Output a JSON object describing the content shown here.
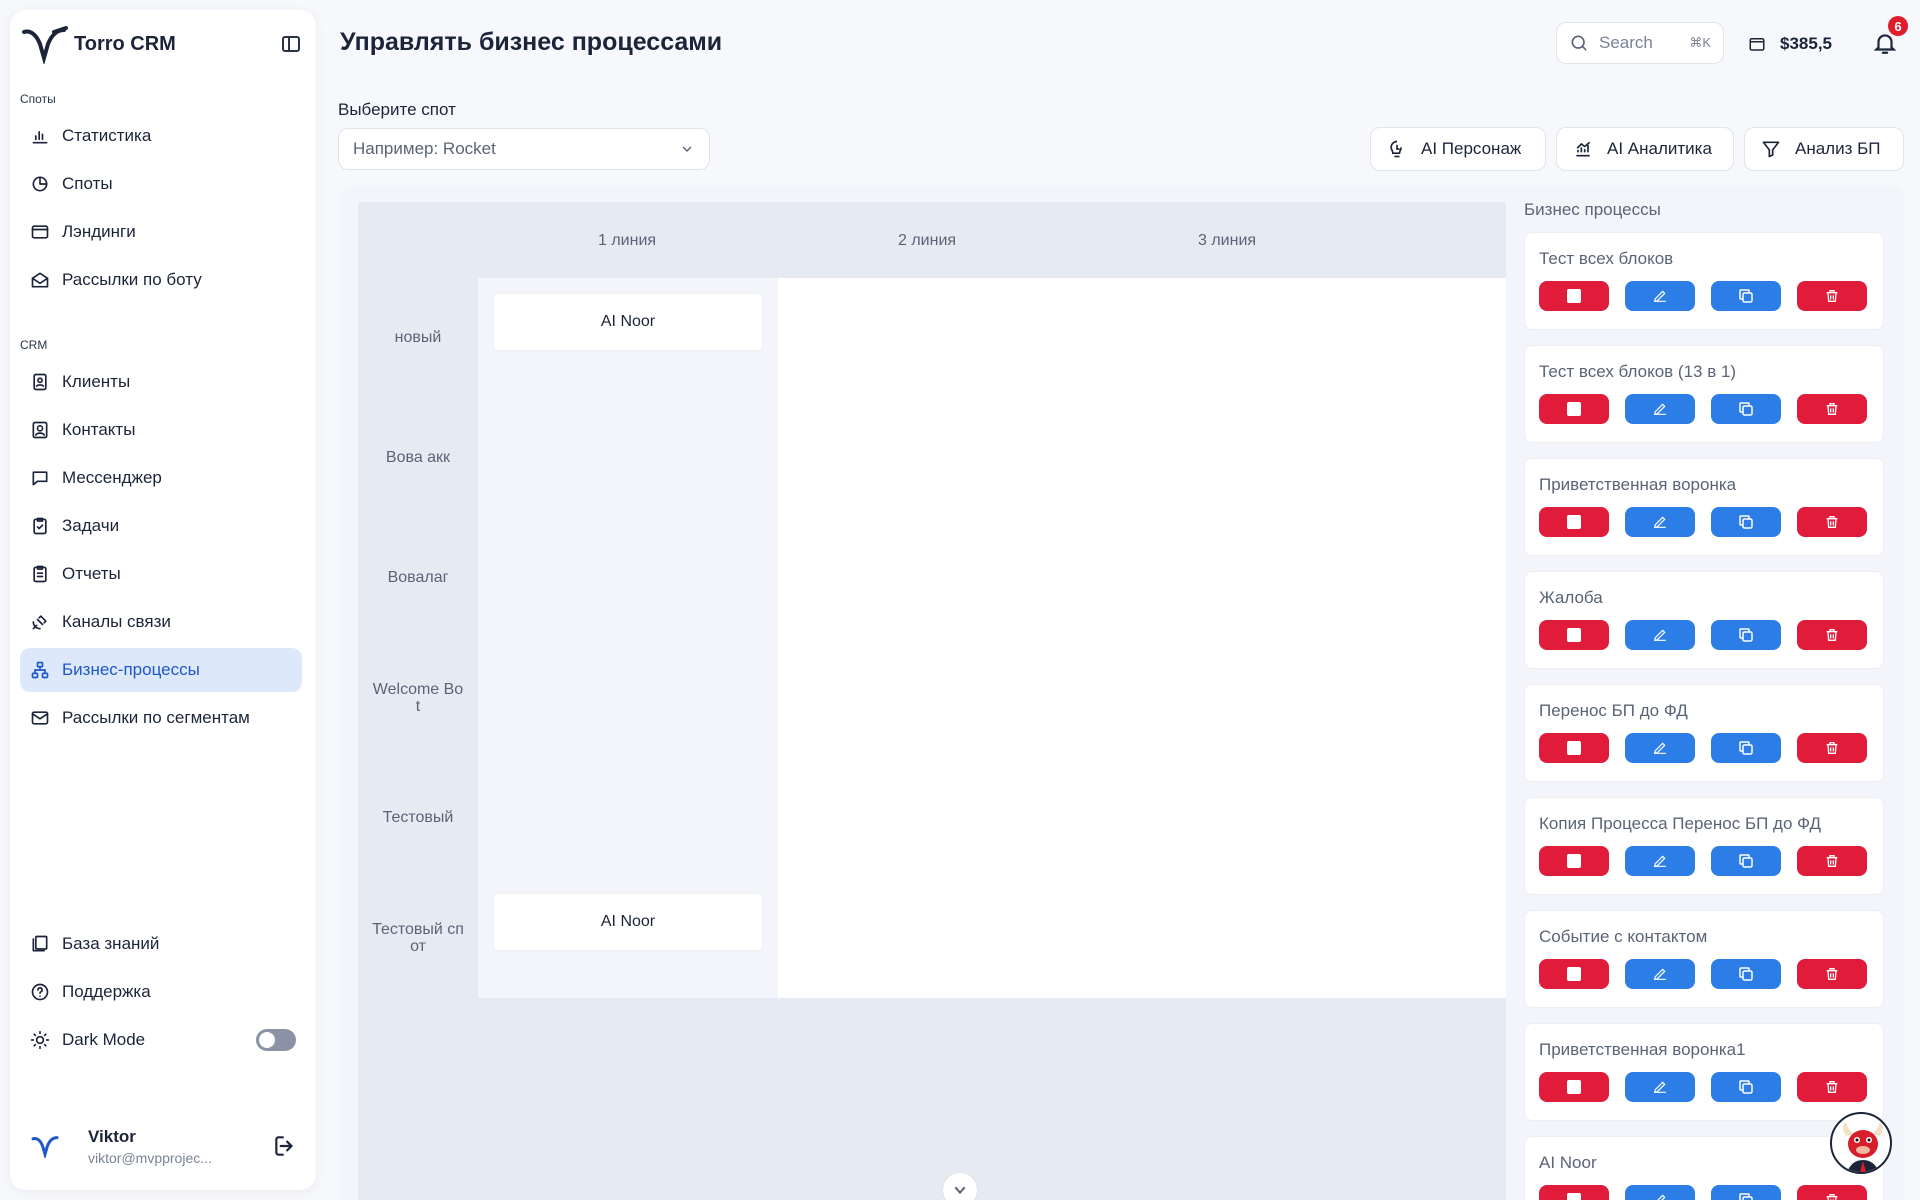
{
  "app": {
    "name": "Torro CRM"
  },
  "sidebar": {
    "section_spots": "Споты",
    "spots_items": [
      {
        "label": "Статистика",
        "icon": "bar-chart-icon"
      },
      {
        "label": "Споты",
        "icon": "pie-chart-icon"
      },
      {
        "label": "Лэндинги",
        "icon": "browser-window-icon"
      },
      {
        "label": "Рассылки по боту",
        "icon": "envelope-open-icon"
      }
    ],
    "section_crm": "CRM",
    "crm_items": [
      {
        "label": "Клиенты",
        "icon": "user-card-icon"
      },
      {
        "label": "Контакты",
        "icon": "contact-book-icon"
      },
      {
        "label": "Мессенджер",
        "icon": "chat-bubble-icon"
      },
      {
        "label": "Задачи",
        "icon": "clipboard-check-icon"
      },
      {
        "label": "Отчеты",
        "icon": "clipboard-list-icon"
      },
      {
        "label": "Каналы связи",
        "icon": "satellite-icon"
      },
      {
        "label": "Бизнес-процессы",
        "icon": "hierarchy-icon",
        "active": true
      },
      {
        "label": "Рассылки по сегментам",
        "icon": "mail-icon"
      }
    ],
    "bottom_items": [
      {
        "label": "База знаний",
        "icon": "books-icon"
      },
      {
        "label": "Поддержка",
        "icon": "help-circle-icon"
      },
      {
        "label": "Dark Mode",
        "icon": "sun-icon"
      }
    ],
    "dark_mode_on": false,
    "user": {
      "name": "Viktor",
      "email": "viktor@mvpprojec..."
    }
  },
  "header": {
    "title": "Управлять бизнес процессами",
    "search_placeholder": "Search",
    "search_shortcut": "⌘K",
    "balance": "$385,5",
    "notifications_count": "6"
  },
  "spot": {
    "label": "Выберите спот",
    "placeholder": "Например: Rocket"
  },
  "actions": {
    "ai_persona": "AI Персонаж",
    "ai_analytics": "AI Аналитика",
    "bp_analysis": "Анализ БП"
  },
  "board": {
    "columns": [
      "1 линия",
      "2 линия",
      "3 линия"
    ],
    "rows": [
      "новый",
      "Вова акк",
      "Вовалаг",
      "Welcome Bo\nt",
      "Тестовый",
      "Тестовый сп\nот"
    ],
    "cards": [
      {
        "row": 0,
        "label": "AI Noor"
      },
      {
        "row": 5,
        "label": "AI Noor"
      }
    ]
  },
  "processes": {
    "title": "Бизнес процессы",
    "items": [
      "Тест всех блоков",
      "Тест всех блоков (13 в 1)",
      "Приветственная воронка",
      "Жалоба",
      "Перенос БП до ФД",
      "Копия Процесса Перенос БП до ФД",
      "Событие с контактом",
      "Приветственная воронка1",
      "AI Noor"
    ]
  },
  "colors": {
    "accent": "#1e58c8",
    "active_bg": "#dde9fb",
    "danger": "#e11c3b",
    "primary_button": "#2d7de6",
    "board_bg": "#e6eaf3"
  }
}
